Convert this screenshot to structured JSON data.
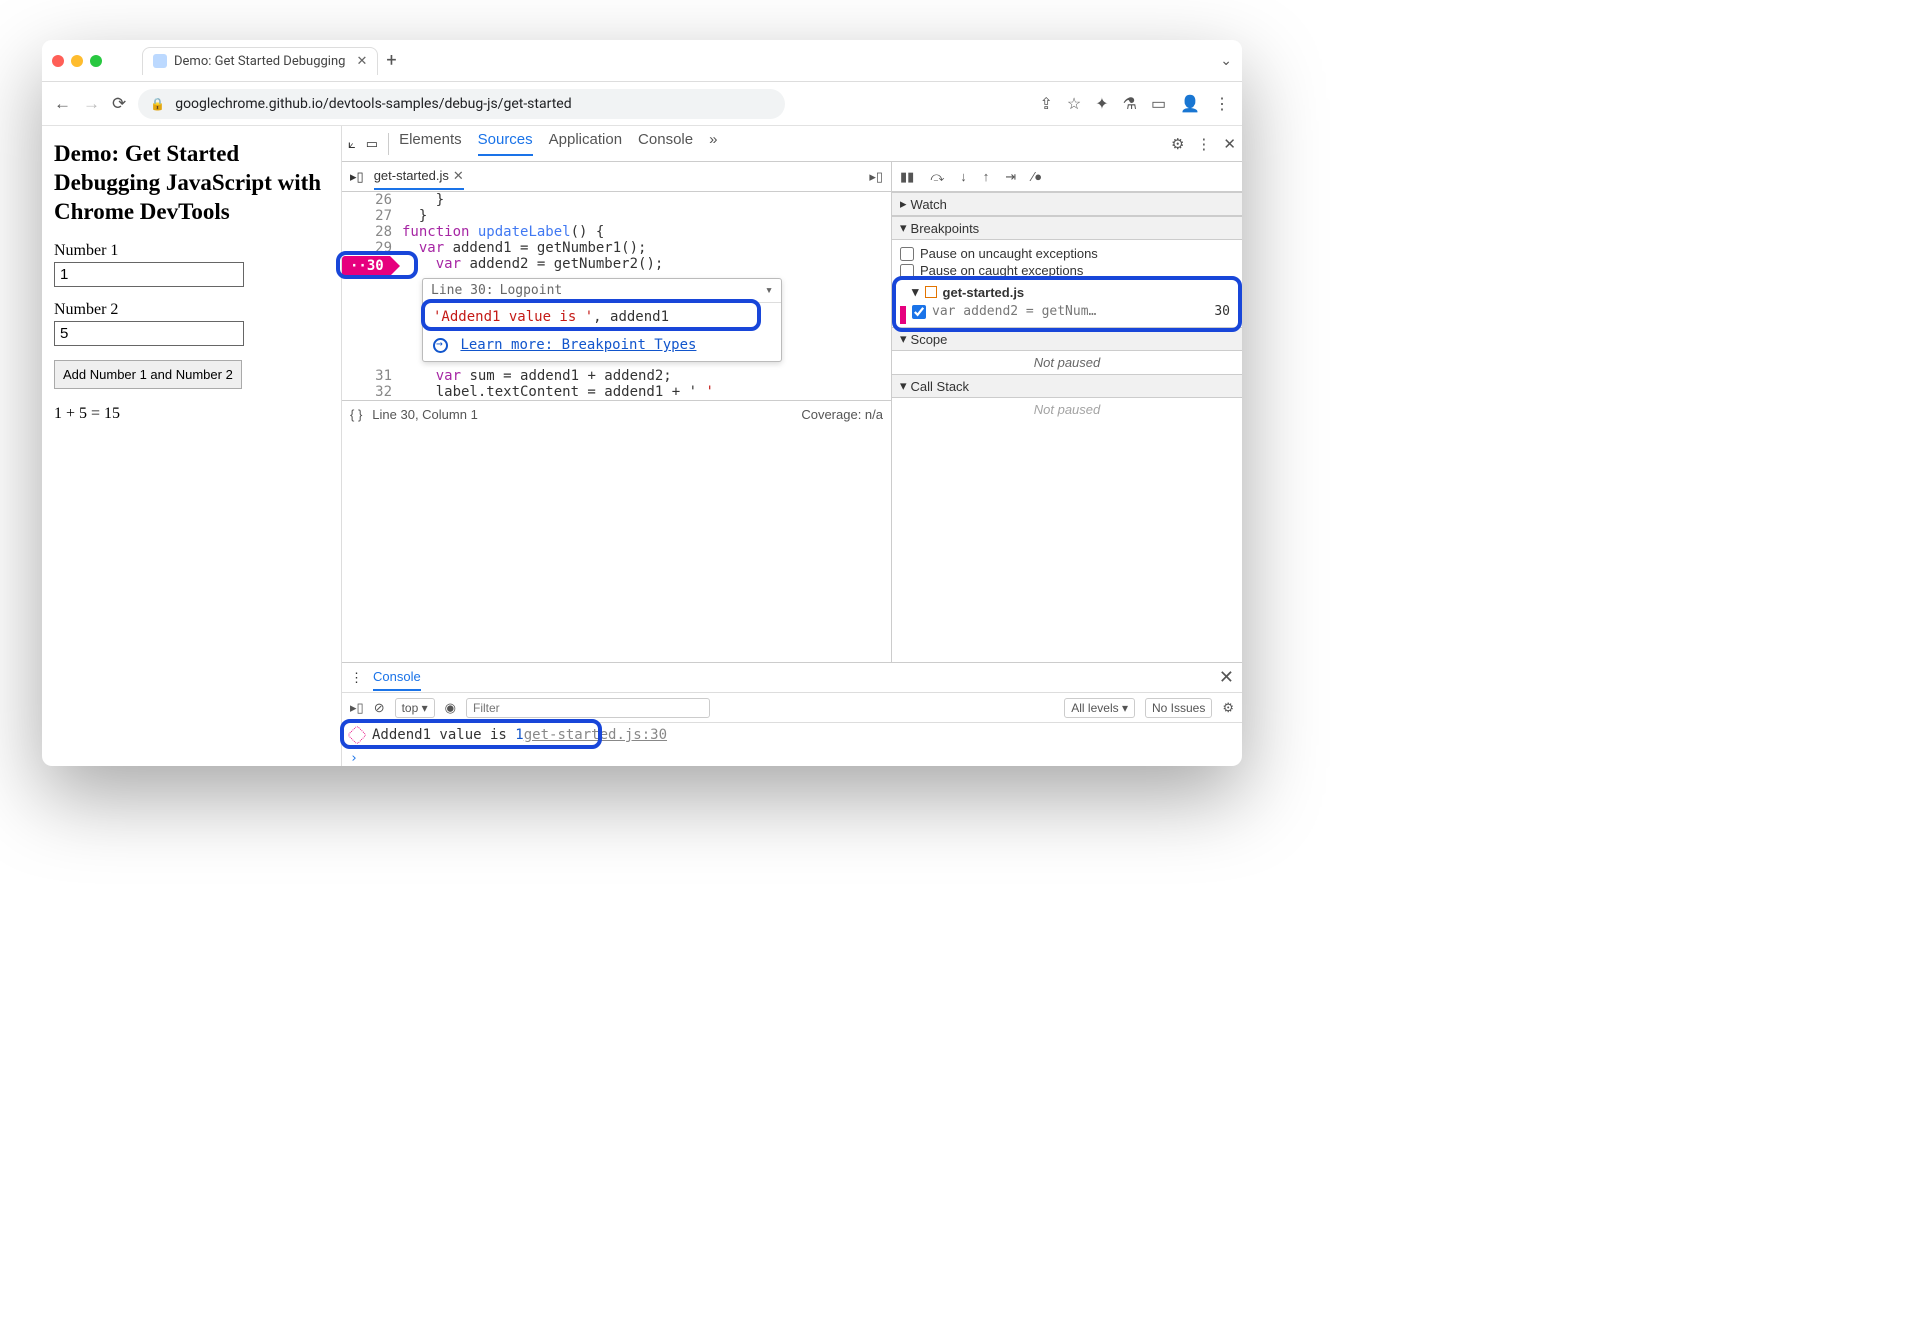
{
  "browser": {
    "tab_title": "Demo: Get Started Debugging",
    "url": "googlechrome.github.io/devtools-samples/debug-js/get-started"
  },
  "demo": {
    "heading": "Demo: Get Started Debugging JavaScript with Chrome DevTools",
    "label1": "Number 1",
    "value1": "1",
    "label2": "Number 2",
    "value2": "5",
    "button": "Add Number 1 and Number 2",
    "result": "1 + 5 = 15"
  },
  "devtools": {
    "tabs": {
      "elements": "Elements",
      "sources": "Sources",
      "application": "Application",
      "console": "Console"
    },
    "file_tab": "get-started.js",
    "code": {
      "l26": "    }",
      "l27": "  }",
      "l28_kw": "function",
      "l28_fn": " updateLabel",
      "l28_rest": "() {",
      "l29_kw": "  var ",
      "l29_id": "addend1",
      "l29_rest": " = getNumber1();",
      "l30_kw": "    var ",
      "l30_id": "addend2",
      "l30_rest": " = getNumber2();",
      "l31_kw": "    var ",
      "l31_id": "sum",
      "l31_rest": " = addend1 + addend2;",
      "l32": "    label.textContent = addend1 + ' "
    },
    "logpoint": {
      "head_line": "Line 30:",
      "head_type": "Logpoint",
      "expr_str": "'Addend1 value is '",
      "expr_rest": ", addend1",
      "learn": "Learn more: Breakpoint Types"
    },
    "status": {
      "pos": "Line 30, Column 1",
      "coverage": "Coverage: n/a",
      "braces": "{ }"
    },
    "debugger": {
      "watch": "Watch",
      "breakpoints": "Breakpoints",
      "pause_uncaught": "Pause on uncaught exceptions",
      "pause_caught": "Pause on caught exceptions",
      "bp_file": "get-started.js",
      "bp_text": "var addend2 = getNum…",
      "bp_line": "30",
      "scope": "Scope",
      "callstack": "Call Stack",
      "notpaused": "Not paused"
    },
    "console": {
      "tab": "Console",
      "top": "top",
      "filter_ph": "Filter",
      "levels": "All levels",
      "issues": "No Issues",
      "msg_text": "Addend1 value is ",
      "msg_val": "1",
      "msg_src": "get-started.js:30"
    }
  },
  "lines": {
    "l26": "26",
    "l27": "27",
    "l28": "28",
    "l29": "29",
    "l30": "30",
    "l31": "31",
    "l32": "32"
  }
}
